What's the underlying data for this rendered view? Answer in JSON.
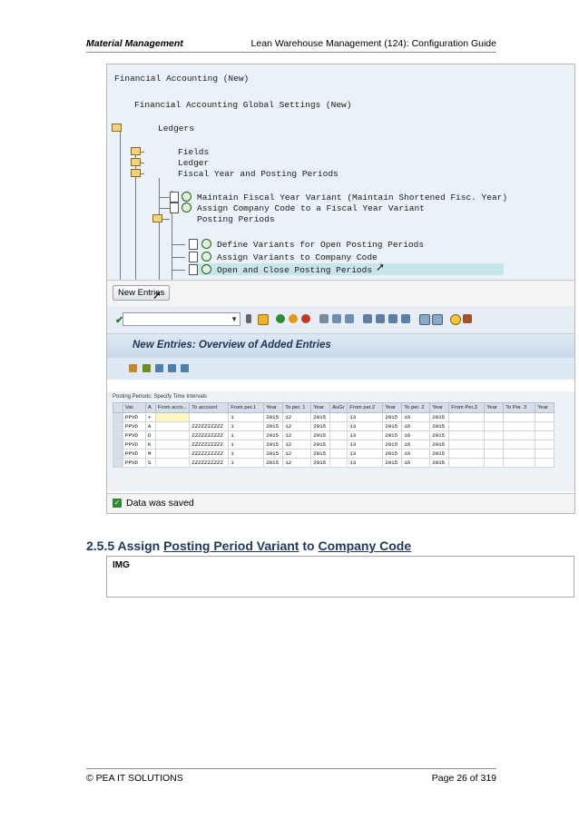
{
  "header": {
    "left": "Material Management",
    "right": "Lean Warehouse Management (124): Configuration Guide"
  },
  "tree": {
    "items": [
      "Financial Accounting (New)",
      "Financial Accounting Global Settings (New)",
      "Ledgers",
      "Fields",
      "Ledger",
      "Fiscal Year and Posting Periods",
      "Maintain Fiscal Year Variant (Maintain Shortened Fisc. Year)",
      "Assign Company Code to a Fiscal Year Variant",
      "Posting Periods",
      "Define Variants for Open Posting Periods",
      "Assign Variants to Company Code",
      "Open and Close Posting Periods"
    ]
  },
  "new_entries_button": "New Entries",
  "screen_title": "New Entries: Overview of Added Entries",
  "table": {
    "caption": "Posting Periods: Specify Time Intervals",
    "columns": [
      "Var.",
      "A",
      "From acco...",
      "To account",
      "From per.1",
      "Year",
      "To per. 1",
      "Year",
      "AuGr",
      "From per.2",
      "Year",
      "To per. 2",
      "Year",
      "From Per.3",
      "Year",
      "To Per. 3",
      "Year"
    ],
    "rows": [
      [
        "PPVD",
        "+",
        "",
        "",
        "1",
        "2015",
        "12",
        "2015",
        "",
        "13",
        "2015",
        "16",
        "2015",
        "",
        "",
        "",
        ""
      ],
      [
        "PPVD",
        "A",
        "",
        "ZZZZZZZZZZ",
        "1",
        "2015",
        "12",
        "2015",
        "",
        "13",
        "2015",
        "16",
        "2015",
        "",
        "",
        "",
        ""
      ],
      [
        "PPVD",
        "D",
        "",
        "ZZZZZZZZZZ",
        "1",
        "2015",
        "12",
        "2015",
        "",
        "13",
        "2015",
        "16",
        "2015",
        "",
        "",
        "",
        ""
      ],
      [
        "PPVD",
        "K",
        "",
        "ZZZZZZZZZZ",
        "1",
        "2015",
        "12",
        "2015",
        "",
        "13",
        "2015",
        "16",
        "2015",
        "",
        "",
        "",
        ""
      ],
      [
        "PPVD",
        "M",
        "",
        "ZZZZZZZZZZ",
        "1",
        "2015",
        "12",
        "2015",
        "",
        "13",
        "2015",
        "16",
        "2015",
        "",
        "",
        "",
        ""
      ],
      [
        "PPVD",
        "S",
        "",
        "ZZZZZZZZZZ",
        "1",
        "2015",
        "12",
        "2015",
        "",
        "13",
        "2015",
        "16",
        "2015",
        "",
        "",
        "",
        ""
      ]
    ]
  },
  "status_message": "Data was saved",
  "section": {
    "number": "2.5.5",
    "word1": "Assign",
    "link1": "Posting Period Variant",
    "word2": "to",
    "link2": "Company Code"
  },
  "img_label": "IMG",
  "footer": {
    "left": "© PEA IT SOLUTIONS",
    "right": "Page 26 of 319"
  }
}
